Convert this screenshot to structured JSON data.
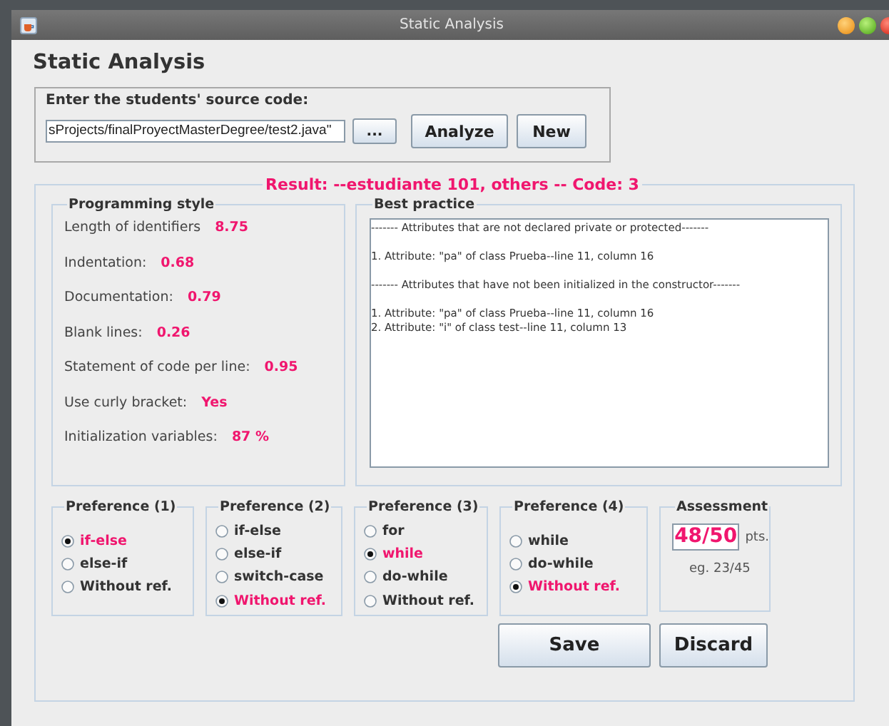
{
  "window": {
    "title": "Static Analysis"
  },
  "heading": "Static Analysis",
  "source": {
    "label": "Enter the students' source code:",
    "path": "sProjects/finalProyectMasterDegree/test2.java\"",
    "browse_button": "...",
    "buttons": [
      "Analyze",
      "New"
    ]
  },
  "result": {
    "title": "Result: --estudiante 101, others -- Code: 3"
  },
  "programming_style": {
    "title": "Programming style",
    "metrics": [
      {
        "label": "Length of identifiers",
        "value": "8.75"
      },
      {
        "label": "Indentation:",
        "value": "0.68"
      },
      {
        "label": "Documentation:",
        "value": "0.79"
      },
      {
        "label": "Blank lines:",
        "value": "0.26"
      },
      {
        "label": "Statement of code per line:",
        "value": "0.95"
      },
      {
        "label": "Use curly bracket:",
        "value": "Yes"
      },
      {
        "label": "Initialization variables:",
        "value": "87 %"
      }
    ]
  },
  "best_practice": {
    "title": "Best practice",
    "blocks": [
      [
        "------- Attributes that are not declared private or protected-------"
      ],
      [
        "1. Attribute: \"pa\" of class Prueba--line 11, column 16"
      ],
      [
        "------- Attributes that have not been initialized in the constructor-------"
      ],
      [
        "1. Attribute: \"pa\" of class Prueba--line 11, column 16",
        "2. Attribute: \"i\" of class test--line 11, column 13"
      ]
    ]
  },
  "preferences": [
    {
      "title": "Preference (1)",
      "options": [
        {
          "label": "if-else",
          "selected": true
        },
        {
          "label": "else-if",
          "selected": false
        },
        {
          "label": "Without ref.",
          "selected": false
        }
      ]
    },
    {
      "title": "Preference (2)",
      "options": [
        {
          "label": "if-else",
          "selected": false
        },
        {
          "label": "else-if",
          "selected": false
        },
        {
          "label": "switch-case",
          "selected": false
        },
        {
          "label": "Without ref.",
          "selected": true
        }
      ]
    },
    {
      "title": "Preference (3)",
      "options": [
        {
          "label": "for",
          "selected": false
        },
        {
          "label": "while",
          "selected": true
        },
        {
          "label": "do-while",
          "selected": false
        },
        {
          "label": "Without ref.",
          "selected": false
        }
      ]
    },
    {
      "title": "Preference (4)",
      "options": [
        {
          "label": "while",
          "selected": false
        },
        {
          "label": "do-while",
          "selected": false
        },
        {
          "label": "Without ref.",
          "selected": true
        }
      ]
    }
  ],
  "assessment": {
    "title": "Assessment",
    "value": "48/50",
    "unit": "pts.",
    "hint": "eg. 23/45"
  },
  "actions": [
    "Save",
    "Discard"
  ]
}
